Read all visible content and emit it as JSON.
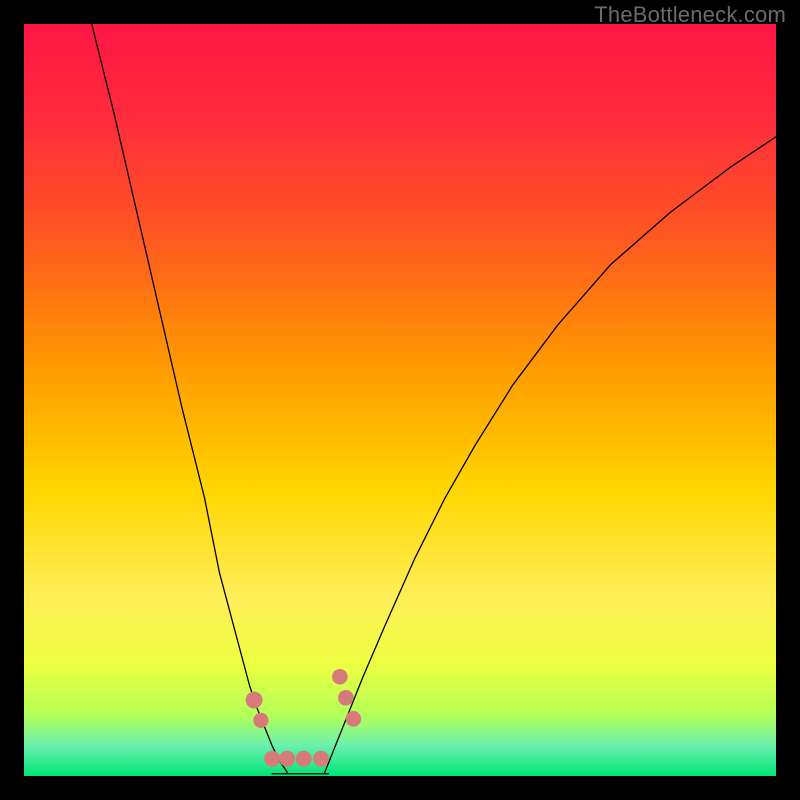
{
  "watermark": {
    "text": "TheBottleneck.com"
  },
  "chart_data": {
    "type": "line",
    "title": "",
    "xlabel": "",
    "ylabel": "",
    "xlim": [
      0,
      100
    ],
    "ylim": [
      0,
      100
    ],
    "legend": false,
    "grid": false,
    "background_gradient": {
      "stops": [
        {
          "offset": 0.0,
          "color": "#ff1744"
        },
        {
          "offset": 0.12,
          "color": "#ff2a3c"
        },
        {
          "offset": 0.28,
          "color": "#ff5722"
        },
        {
          "offset": 0.45,
          "color": "#ff9800"
        },
        {
          "offset": 0.62,
          "color": "#ffd600"
        },
        {
          "offset": 0.76,
          "color": "#ffee58"
        },
        {
          "offset": 0.85,
          "color": "#eeff41"
        },
        {
          "offset": 0.92,
          "color": "#b2ff59"
        },
        {
          "offset": 0.96,
          "color": "#69f0ae"
        },
        {
          "offset": 1.0,
          "color": "#00e676"
        }
      ]
    },
    "series": [
      {
        "name": "left-curve",
        "x": [
          9,
          12,
          15,
          18,
          21,
          24,
          26,
          28,
          30,
          31,
          32,
          33,
          34,
          35
        ],
        "y": [
          100,
          88,
          75,
          62,
          49,
          37,
          27,
          19.5,
          12,
          9,
          6.5,
          4,
          2,
          0.5
        ],
        "color": "#000000",
        "lw": 1.3
      },
      {
        "name": "right-curve",
        "x": [
          40,
          41,
          43,
          45,
          48,
          52,
          56,
          60,
          65,
          71,
          78,
          86,
          94,
          100
        ],
        "y": [
          0.5,
          3,
          8,
          13,
          20,
          29,
          37,
          44,
          52,
          60,
          68,
          75,
          81,
          85
        ],
        "color": "#000000",
        "lw": 1.3
      },
      {
        "name": "bottom-flat",
        "x": [
          33,
          40.5
        ],
        "y": [
          0.3,
          0.3
        ],
        "color": "#000000",
        "lw": 1.3
      }
    ],
    "markers": [
      {
        "name": "left-marker-upper",
        "x": 30.6,
        "y": 10.1,
        "r": 8.5,
        "color": "#d77a7a"
      },
      {
        "name": "left-marker-lower",
        "x": 31.5,
        "y": 7.4,
        "r": 7.6,
        "color": "#d77a7a"
      },
      {
        "name": "right-marker-top",
        "x": 42.0,
        "y": 13.2,
        "r": 7.8,
        "color": "#d77a7a"
      },
      {
        "name": "right-marker-upper",
        "x": 42.8,
        "y": 10.4,
        "r": 7.8,
        "color": "#d77a7a"
      },
      {
        "name": "right-marker-lower",
        "x": 43.8,
        "y": 7.6,
        "r": 7.8,
        "color": "#d77a7a"
      },
      {
        "name": "bottom-lozenge-left",
        "x": 33.0,
        "y": 2.3,
        "r": 8,
        "color": "#d77a7a"
      },
      {
        "name": "bottom-lozenge-mid1",
        "x": 35.0,
        "y": 2.3,
        "r": 8,
        "color": "#d77a7a"
      },
      {
        "name": "bottom-lozenge-mid2",
        "x": 37.2,
        "y": 2.3,
        "r": 8,
        "color": "#d77a7a"
      },
      {
        "name": "bottom-lozenge-right",
        "x": 39.5,
        "y": 2.3,
        "r": 8,
        "color": "#d77a7a"
      }
    ]
  }
}
